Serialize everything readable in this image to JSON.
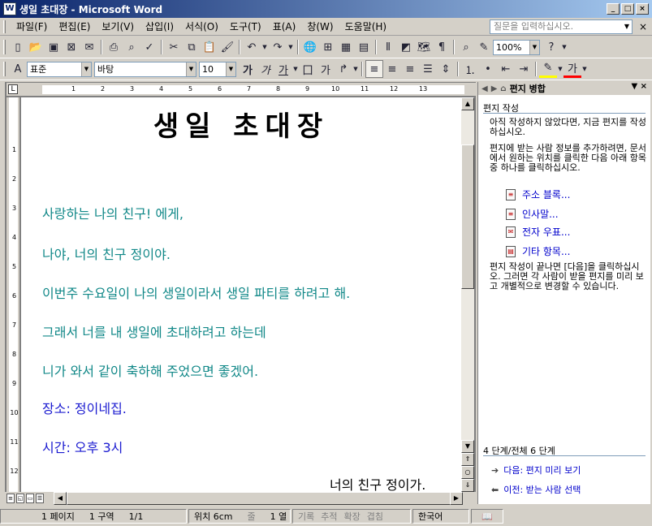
{
  "window": {
    "title": "생일 초대장 - Microsoft Word",
    "icon_label": "W"
  },
  "menu": {
    "items": [
      "파일(F)",
      "편집(E)",
      "보기(V)",
      "삽입(I)",
      "서식(O)",
      "도구(T)",
      "표(A)",
      "창(W)",
      "도움말(H)"
    ],
    "help_placeholder": "질문을 입력하십시오."
  },
  "toolbar": {
    "zoom": "100%",
    "style": "표준",
    "font": "바탕",
    "size": "10"
  },
  "document": {
    "title": "생일 초대장",
    "lines": [
      {
        "text": "사랑하는 나의 친구! 에게,",
        "color": "#118888"
      },
      {
        "text": "나야, 너의 친구 정이야.",
        "color": "#118888"
      },
      {
        "text": "이번주 수요일이 나의 생일이라서 생일 파티를 하려고 해.",
        "color": "#118888"
      },
      {
        "text": "그래서 너를 내 생일에 초대하려고 하는데",
        "color": "#118888"
      },
      {
        "text": "니가 와서 같이 축하해 주었으면 좋겠어.",
        "color": "#118888"
      },
      {
        "text": "장소: 정이네집.",
        "color": "#1a1ad0"
      },
      {
        "text": "시간: 오후 3시",
        "color": "#1a1ad0"
      }
    ],
    "signature": "너의 친구 정이가."
  },
  "taskpane": {
    "title": "편지 병합",
    "section": "편지 작성",
    "para1": "아직 작성하지 않았다면, 지금 편지를 작성하십시오.",
    "para2": "편지에 받는 사람 정보를 추가하려면, 문서에서 원하는 위치를 클릭한 다음 아래 항목 중 하나를 클릭하십시오.",
    "links": [
      "주소 블록...",
      "인사말...",
      "전자 우표...",
      "기타 항목..."
    ],
    "para3": "편지 작성이 끝나면 [다음]을 클릭하십시오. 그러면 각 사람이 받을 편지를 미리 보고 개별적으로 변경할 수 있습니다.",
    "step": "4 단계/전체 6 단계",
    "next": "다음: 편지 미리 보기",
    "prev": "이전: 받는 사람 선택"
  },
  "statusbar": {
    "page": "1 페이지",
    "section": "1 구역",
    "pages": "1/1",
    "position": "위치 6cm",
    "line": "줄",
    "column": "1 열",
    "rec": "기록",
    "trk": "추적",
    "ext": "확장",
    "ovr": "겹침",
    "language": "한국어"
  }
}
